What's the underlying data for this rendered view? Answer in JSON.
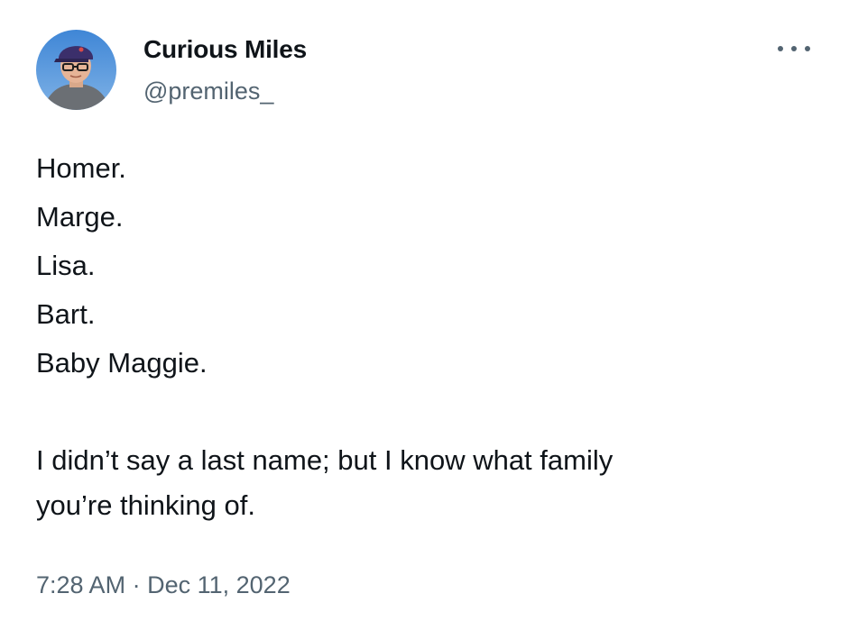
{
  "author": {
    "display_name": "Curious Miles",
    "handle": "@premiles_",
    "avatar": "profile-photo-man-with-cap-and-glasses"
  },
  "menu_icon": "more-horizontal-icon",
  "tweet": {
    "lines": [
      "Homer.",
      "Marge.",
      "Lisa.",
      "Bart.",
      "Baby Maggie."
    ],
    "paragraph": [
      "I didn’t say a last name; but I know what family",
      "you’re thinking of."
    ]
  },
  "meta": {
    "time": "7:28 AM",
    "separator": "·",
    "date": "Dec 11, 2022"
  },
  "colors": {
    "text": "#0f1419",
    "secondary": "#536471",
    "background": "#ffffff"
  }
}
